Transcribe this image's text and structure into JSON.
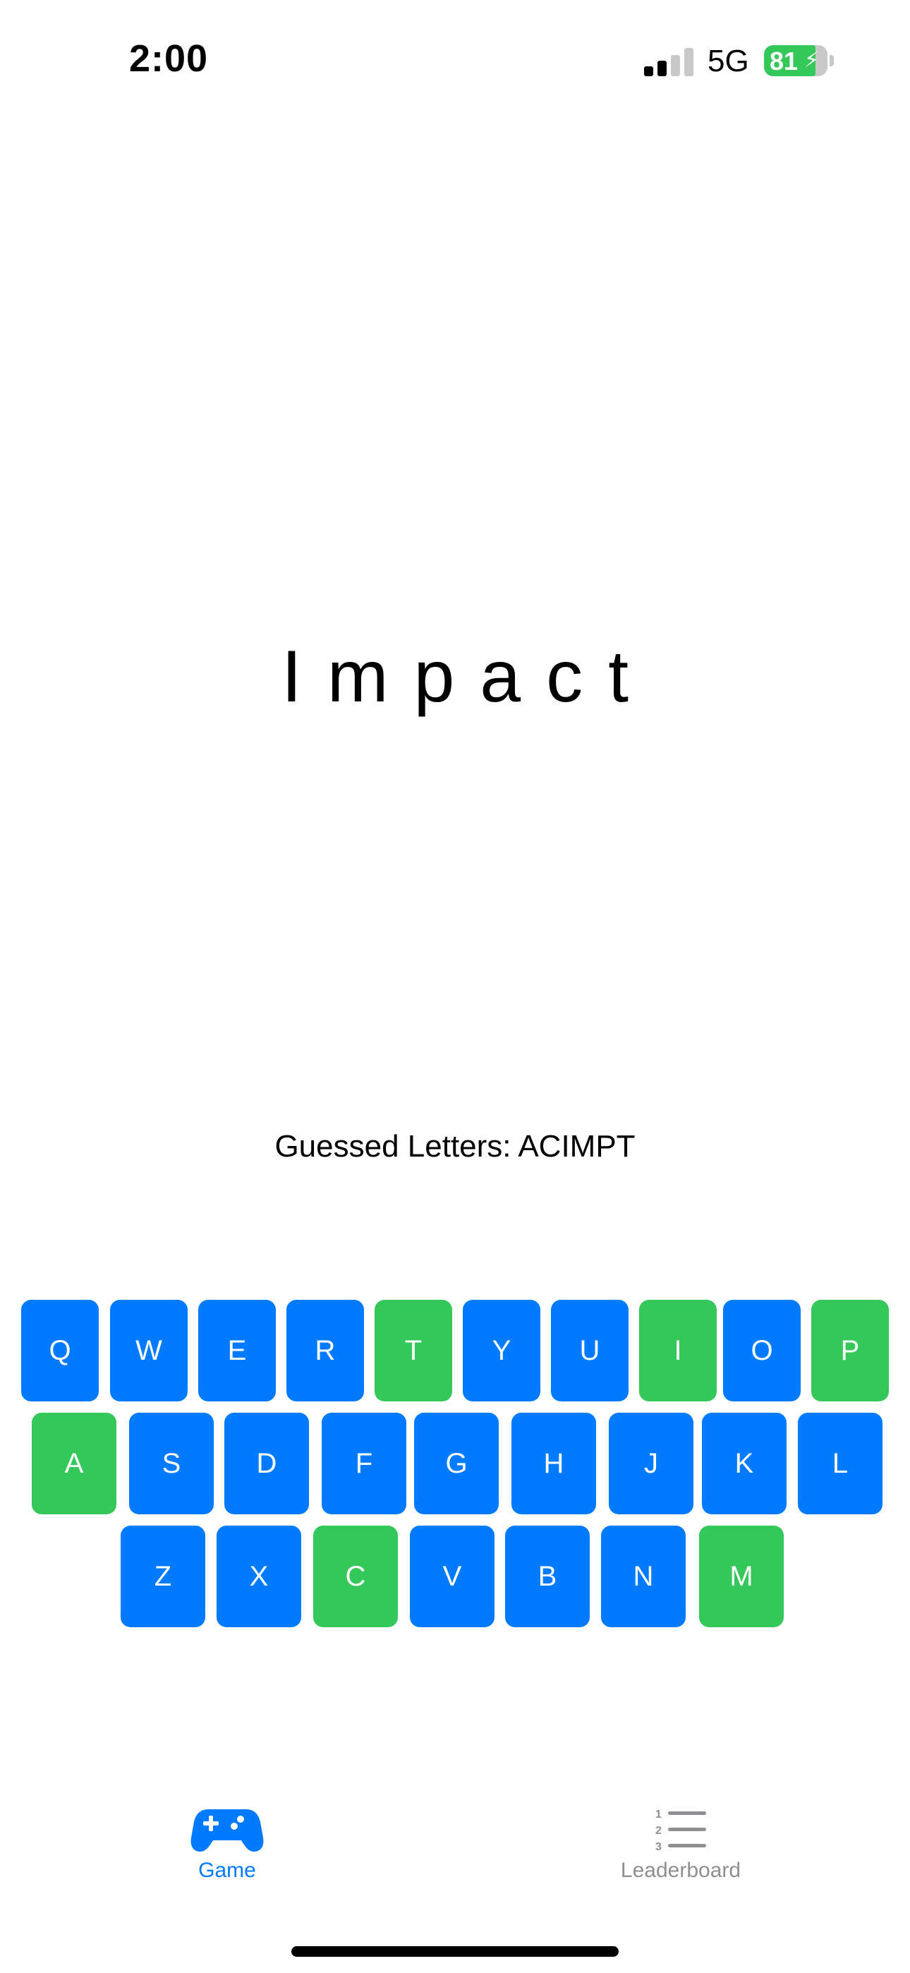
{
  "status_bar": {
    "time": "2:00",
    "network": "5G",
    "battery": "81",
    "battery_level": 0.81,
    "battery_icon": "charging-bolt-icon"
  },
  "game": {
    "word": "Impact",
    "guessed_label": "Guessed Letters: ACIMPT",
    "colors": {
      "unguessed": "#007aff",
      "guessed": "#34c759"
    }
  },
  "keyboard": {
    "row1": [
      {
        "letter": "Q",
        "guessed": false
      },
      {
        "letter": "W",
        "guessed": false
      },
      {
        "letter": "E",
        "guessed": false
      },
      {
        "letter": "R",
        "guessed": false
      },
      {
        "letter": "T",
        "guessed": true
      },
      {
        "letter": "Y",
        "guessed": false
      },
      {
        "letter": "U",
        "guessed": false
      },
      {
        "letter": "I",
        "guessed": true
      },
      {
        "letter": "O",
        "guessed": false
      },
      {
        "letter": "P",
        "guessed": true
      }
    ],
    "row2": [
      {
        "letter": "A",
        "guessed": true
      },
      {
        "letter": "S",
        "guessed": false
      },
      {
        "letter": "D",
        "guessed": false
      },
      {
        "letter": "F",
        "guessed": false
      },
      {
        "letter": "G",
        "guessed": false
      },
      {
        "letter": "H",
        "guessed": false
      },
      {
        "letter": "J",
        "guessed": false
      },
      {
        "letter": "K",
        "guessed": false
      },
      {
        "letter": "L",
        "guessed": false
      }
    ],
    "row3": [
      {
        "letter": "Z",
        "guessed": false
      },
      {
        "letter": "X",
        "guessed": false
      },
      {
        "letter": "C",
        "guessed": true
      },
      {
        "letter": "V",
        "guessed": false
      },
      {
        "letter": "B",
        "guessed": false
      },
      {
        "letter": "N",
        "guessed": false
      },
      {
        "letter": "M",
        "guessed": true
      }
    ]
  },
  "tab_bar": {
    "tabs": [
      {
        "label": "Game",
        "icon": "gamecontroller-icon",
        "selected": true,
        "color": "#007aff"
      },
      {
        "label": "Leaderboard",
        "icon": "numbered-list-icon",
        "selected": false,
        "color": "#8e8e93"
      }
    ]
  }
}
